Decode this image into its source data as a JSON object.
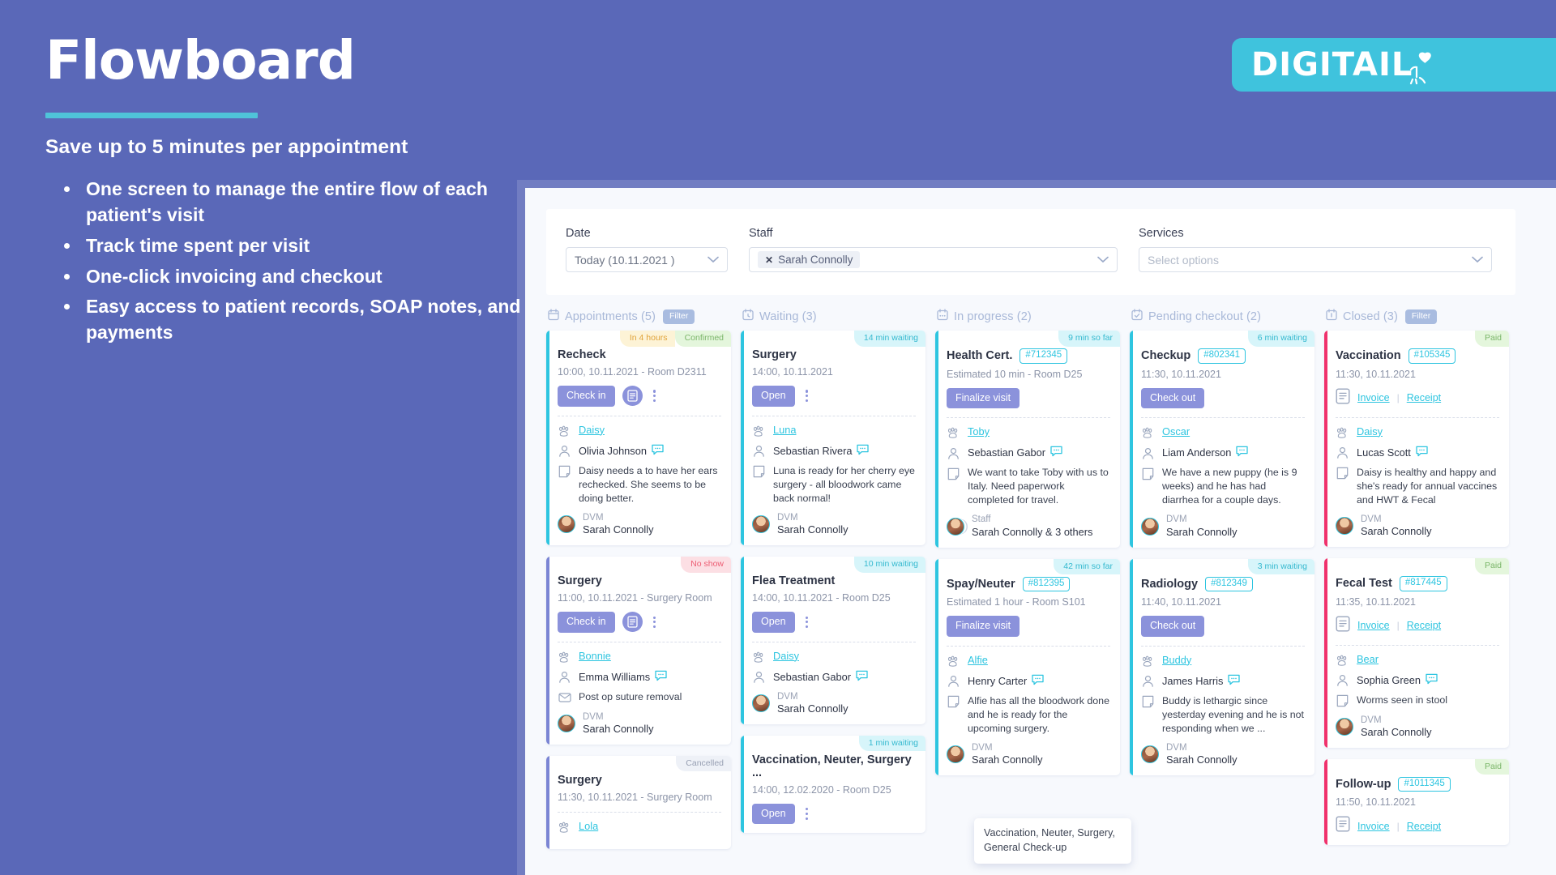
{
  "promo": {
    "title": "Flowboard",
    "subtitle": "Save up to 5 minutes per appointment",
    "bullets": [
      "One screen to manage the entire flow of each patient's visit",
      "Track time spent per visit",
      "One-click invoicing and checkout",
      "Easy access to patient records, SOAP notes, and payments"
    ]
  },
  "logo": {
    "text": "DIGITAIL",
    "accent": "#3fc3dd"
  },
  "filters": {
    "date": {
      "label": "Date",
      "value": "Today (10.11.2021 )"
    },
    "staff": {
      "label": "Staff",
      "chips": [
        "Sarah Connolly"
      ]
    },
    "services": {
      "label": "Services",
      "placeholder": "Select options"
    }
  },
  "columns": [
    {
      "id": "appointments",
      "title": "Appointments (5)",
      "icon": "calendar-icon",
      "filter_label": "Filter",
      "has_filter": true,
      "cards": [
        {
          "badges": [
            {
              "text": "In 4 hours",
              "bg": "#fdf3d6",
              "fg": "#e0a33a"
            },
            {
              "text": "Confirmed",
              "bg": "#e4f6dc",
              "fg": "#7bb66a"
            }
          ],
          "spine": "#2ec5e0",
          "title": "Recheck",
          "meta": "10:00, 10.11.2021  - Room D2311",
          "action": "Check in",
          "has_doc_icon": true,
          "has_kebab": true,
          "pet": "Daisy",
          "owner": "Olivia Johnson",
          "note": "Daisy needs a to have her ears rechecked. She seems to be doing better.",
          "note_icon": "note-icon",
          "staff_role": "DVM",
          "staff_name": "Sarah Connolly"
        },
        {
          "badges": [
            {
              "text": "No show",
              "bg": "#fcdfe4",
              "fg": "#ec5d73"
            }
          ],
          "spine": "#7b85d4",
          "title": "Surgery",
          "meta": "11:00, 10.11.2021 - Surgery Room",
          "action": "Check in",
          "has_doc_icon": true,
          "has_kebab": true,
          "pet": "Bonnie",
          "owner": "Emma Williams",
          "note": "Post op suture removal",
          "note_icon": "envelope-icon",
          "staff_role": "DVM",
          "staff_name": "Sarah Connolly"
        },
        {
          "badges": [
            {
              "text": "Cancelled",
              "bg": "#eef1f7",
              "fg": "#98a0b3"
            }
          ],
          "spine": "#7b85d4",
          "title": "Surgery",
          "meta": "11:30, 10.11.2021 - Surgery Room",
          "pet": "Lola"
        }
      ]
    },
    {
      "id": "waiting",
      "title": "Waiting (3)",
      "icon": "clock-calendar-icon",
      "has_filter": false,
      "cards": [
        {
          "badges": [
            {
              "text": "14 min waiting",
              "bg": "#d7f5fa",
              "fg": "#35b9cf"
            }
          ],
          "spine": "#2ec5e0",
          "title": "Surgery",
          "meta": "14:00, 10.11.2021",
          "action": "Open",
          "has_kebab": true,
          "pet": "Luna",
          "owner": "Sebastian Rivera",
          "note": "Luna is ready for her cherry eye surgery - all bloodwork came back normal!",
          "note_icon": "note-icon",
          "staff_role": "DVM",
          "staff_name": "Sarah Connolly"
        },
        {
          "badges": [
            {
              "text": "10 min waiting",
              "bg": "#d7f5fa",
              "fg": "#35b9cf"
            }
          ],
          "spine": "#2ec5e0",
          "title": "Flea Treatment",
          "meta": "14:00, 10.11.2021  - Room D25",
          "action": "Open",
          "has_kebab": true,
          "pet": "Daisy",
          "owner": "Sebastian Gabor",
          "staff_role": "DVM",
          "staff_name": "Sarah Connolly"
        },
        {
          "badges": [
            {
              "text": "1 min waiting",
              "bg": "#d7f5fa",
              "fg": "#35b9cf"
            }
          ],
          "spine": "#2ec5e0",
          "title": "Vaccination, Neuter, Surgery ...",
          "meta": "14:00, 12.02.2020 - Room D25",
          "action": "Open",
          "has_kebab": true
        }
      ]
    },
    {
      "id": "in-progress",
      "title": "In progress (2)",
      "icon": "progress-calendar-icon",
      "has_filter": false,
      "cards": [
        {
          "badges": [
            {
              "text": "9 min so far",
              "bg": "#d7f5fa",
              "fg": "#35b9cf"
            }
          ],
          "spine": "#2ec5e0",
          "title": "Health Cert.",
          "id_badge": "#712345",
          "meta": "Estimated 10 min - Room D25",
          "action": "Finalize visit",
          "pet": "Toby",
          "owner": "Sebastian Gabor",
          "note": "We want to take Toby with us to Italy.  Need paperwork completed for travel.",
          "note_icon": "note-icon",
          "staff_role": "Staff",
          "staff_name": "Sarah Connolly & 3 others",
          "staff_multi": true
        },
        {
          "badges": [
            {
              "text": "42 min so far",
              "bg": "#d7f5fa",
              "fg": "#35b9cf"
            }
          ],
          "spine": "#2ec5e0",
          "title": "Spay/Neuter",
          "id_badge": "#812395",
          "meta": "Estimated 1 hour - Room S101",
          "action": "Finalize visit",
          "pet": "Alfie",
          "owner": "Henry Carter",
          "note": "Alfie has all the bloodwork done and he is ready for the upcoming surgery.",
          "note_icon": "note-icon",
          "staff_role": "DVM",
          "staff_name": "Sarah Connolly"
        }
      ]
    },
    {
      "id": "pending-checkout",
      "title": "Pending checkout (2)",
      "icon": "checkout-calendar-icon",
      "has_filter": false,
      "cards": [
        {
          "badges": [
            {
              "text": "6 min waiting",
              "bg": "#d7f5fa",
              "fg": "#35b9cf"
            }
          ],
          "spine": "#2ec5e0",
          "title": "Checkup",
          "id_badge": "#802341",
          "meta": "11:30, 10.11.2021",
          "action": "Check out",
          "pet": "Oscar",
          "owner": "Liam Anderson",
          "note": "We have a new puppy (he is 9 weeks) and he has had diarrhea for a couple days.",
          "note_icon": "note-icon",
          "staff_role": "DVM",
          "staff_name": "Sarah Connolly"
        },
        {
          "badges": [
            {
              "text": "3 min waiting",
              "bg": "#d7f5fa",
              "fg": "#35b9cf"
            }
          ],
          "spine": "#2ec5e0",
          "title": "Radiology",
          "id_badge": "#812349",
          "meta": "11:40, 10.11.2021",
          "action": "Check out",
          "pet": "Buddy",
          "owner": "James Harris",
          "note": "Buddy is lethargic since yesterday evening and he is not responding when we  ...",
          "note_icon": "note-icon",
          "staff_role": "DVM",
          "staff_name": "Sarah Connolly"
        }
      ]
    },
    {
      "id": "closed",
      "title": "Closed (3)",
      "icon": "closed-calendar-icon",
      "filter_label": "Filter",
      "has_filter": true,
      "cards": [
        {
          "badges": [
            {
              "text": "Paid",
              "bg": "#e4f6dc",
              "fg": "#7bb66a"
            }
          ],
          "spine": "#f0316c",
          "title": "Vaccination",
          "id_badge": "#105345",
          "meta": "11:30, 10.11.2021",
          "invoice_label": "Invoice",
          "receipt_label": "Receipt",
          "pet": "Daisy",
          "owner": "Lucas Scott",
          "note": "Daisy is healthy and happy and she's ready for annual vaccines and HWT & Fecal",
          "note_icon": "note-icon",
          "staff_role": "DVM",
          "staff_name": "Sarah Connolly"
        },
        {
          "badges": [
            {
              "text": "Paid",
              "bg": "#e4f6dc",
              "fg": "#7bb66a"
            }
          ],
          "spine": "#f0316c",
          "title": "Fecal Test",
          "id_badge": "#817445",
          "meta": "11:35, 10.11.2021",
          "invoice_label": "Invoice",
          "receipt_label": "Receipt",
          "pet": "Bear",
          "owner": "Sophia Green",
          "note": "Worms seen in stool",
          "note_icon": "note-icon",
          "staff_role": "DVM",
          "staff_name": "Sarah Connolly"
        },
        {
          "badges": [
            {
              "text": "Paid",
              "bg": "#e4f6dc",
              "fg": "#7bb66a"
            }
          ],
          "spine": "#f0316c",
          "title": "Follow-up",
          "id_badge": "#1011345",
          "meta": "11:50, 10.11.2021",
          "invoice_label": "Invoice",
          "receipt_label": "Receipt"
        }
      ]
    }
  ],
  "tooltip": {
    "text": "Vaccination, Neuter, Surgery, General Check-up"
  }
}
